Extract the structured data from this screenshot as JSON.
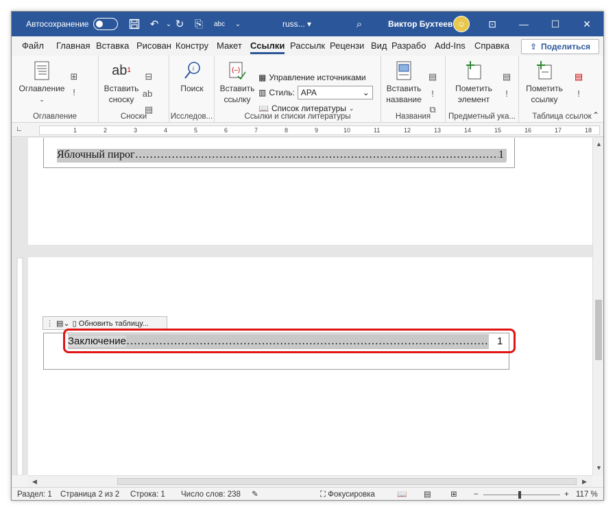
{
  "titlebar": {
    "autosave_label": "Автосохранение",
    "doc_title": "russ... ▾",
    "user_name": "Виктор Бухтеев",
    "save_icon": "save-icon",
    "undo_icon": "undo-icon",
    "redo_icon": "redo-icon",
    "spelling_icon": "abc"
  },
  "tabs": [
    "Файл",
    "Главная",
    "Вставка",
    "Рисован",
    "Констру",
    "Макет",
    "Ссылки",
    "Рассылк",
    "Рецензи",
    "Вид",
    "Разрабо",
    "Add-Ins",
    "Справка"
  ],
  "active_tab": "Ссылки",
  "share_label": "Поделиться",
  "ribbon": {
    "toc": {
      "button": "Оглавление",
      "group": "Оглавление"
    },
    "footnotes": {
      "button_line1": "Вставить",
      "button_line2": "сноску",
      "group": "Сноски"
    },
    "research": {
      "button": "Поиск",
      "group": "Исследов..."
    },
    "citations": {
      "button_line1": "Вставить",
      "button_line2": "ссылку",
      "manage_sources": "Управление источниками",
      "style_label": "Стиль:",
      "style_value": "APA",
      "bibliography": "Список литературы",
      "group": "Ссылки и списки литературы"
    },
    "captions": {
      "button_line1": "Вставить",
      "button_line2": "название",
      "group": "Названия"
    },
    "index": {
      "button_line1": "Пометить",
      "button_line2": "элемент",
      "group": "Предметный ука..."
    },
    "authorities": {
      "button_line1": "Пометить",
      "button_line2": "ссылку",
      "group": "Таблица ссылок"
    }
  },
  "ruler_numbers": [
    "1",
    "2",
    "3",
    "4",
    "5",
    "6",
    "7",
    "8",
    "9",
    "10",
    "11",
    "12",
    "13",
    "14",
    "15",
    "16",
    "17",
    "18"
  ],
  "document": {
    "toc_entry_1": {
      "text": "Яблочный пирог",
      "page": "1"
    },
    "field_toolbar_label": "Обновить таблицу...",
    "toc_entry_2": {
      "text": "Заключение",
      "page": "1"
    }
  },
  "statusbar": {
    "section": "Раздел: 1",
    "page": "Страница 2 из 2",
    "line": "Строка: 1",
    "words": "Число слов: 238",
    "focus": "Фокусировка",
    "zoom": "117 %",
    "minus": "−",
    "plus": "+"
  }
}
